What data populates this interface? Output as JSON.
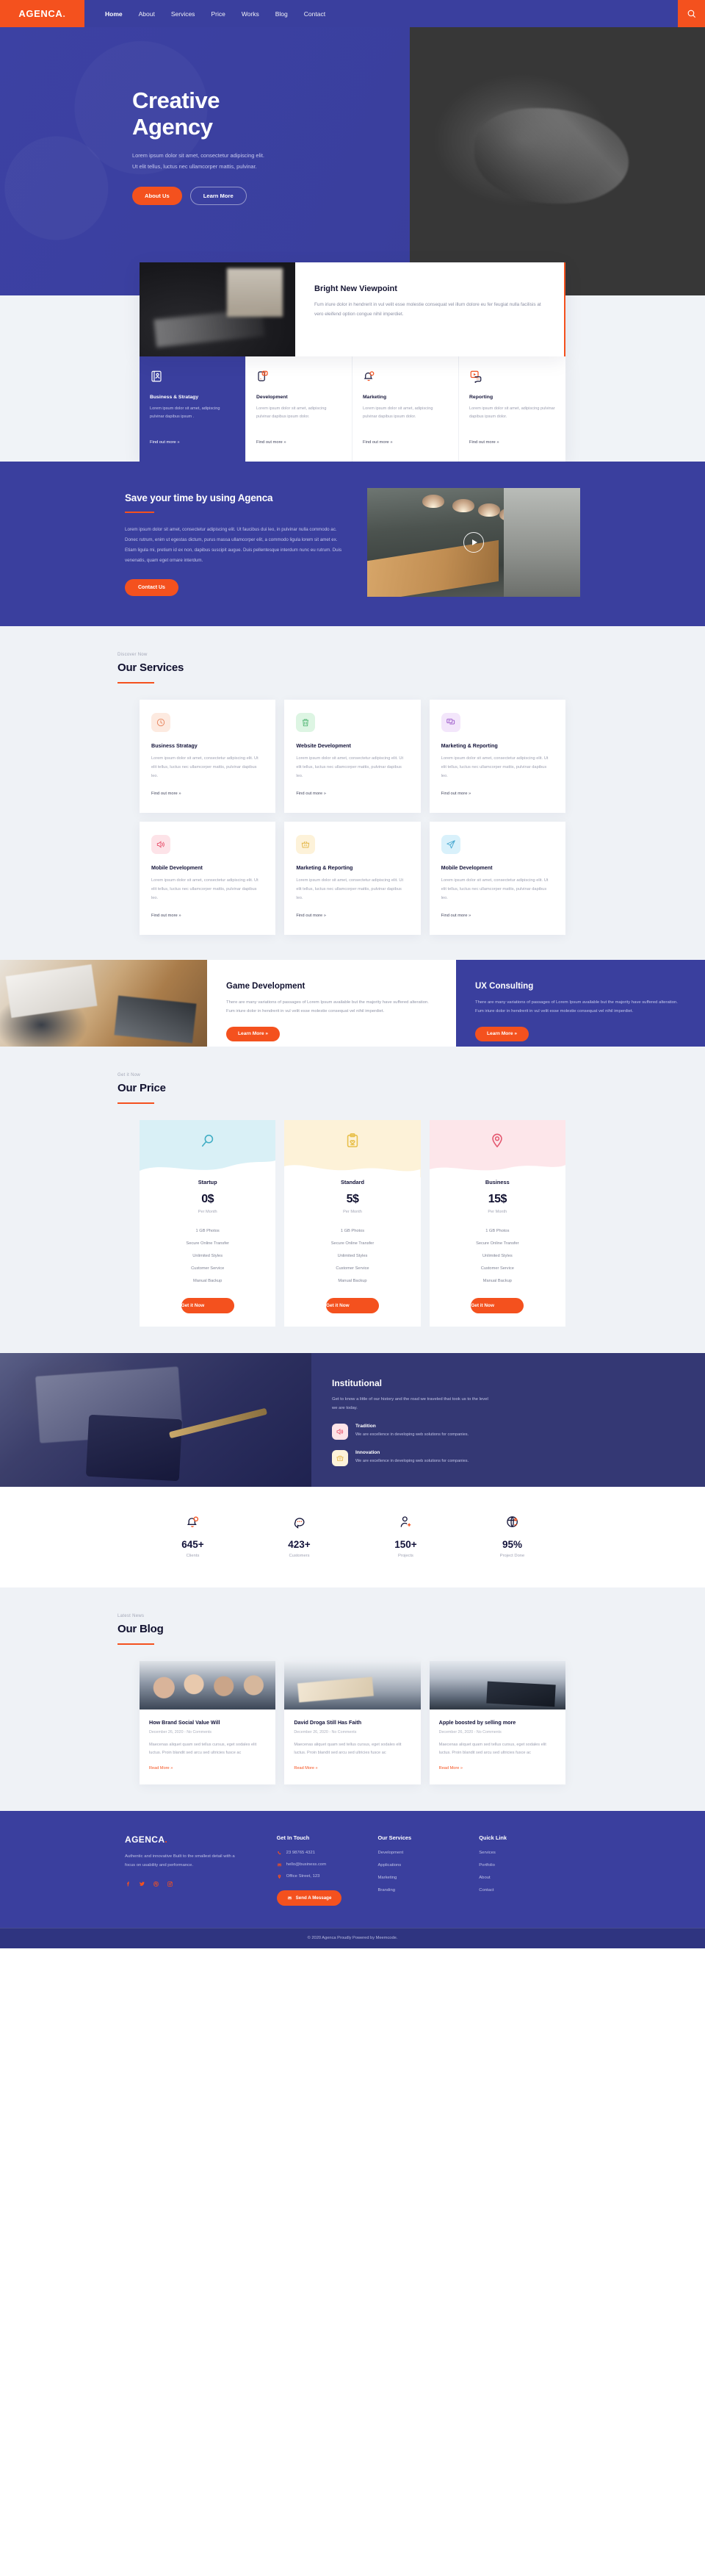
{
  "brand": {
    "name": "AGENCA",
    "dot": "."
  },
  "colors": {
    "primary": "#3a3f9e",
    "accent": "#f4511e",
    "dark": "#343874",
    "bg_grey": "#eff2f6"
  },
  "header": {
    "nav": [
      {
        "label": "Home",
        "active": true
      },
      {
        "label": "About",
        "active": false
      },
      {
        "label": "Services",
        "active": false
      },
      {
        "label": "Price",
        "active": false
      },
      {
        "label": "Works",
        "active": false
      },
      {
        "label": "Blog",
        "active": false
      },
      {
        "label": "Contact",
        "active": false
      }
    ],
    "search_icon": "search-icon"
  },
  "hero": {
    "title_line1": "Creative",
    "title_line2": "Agency",
    "subtitle": "Lorem ipsum dolor sit amet, consectetur adipiscing elit. Ut elit tellus, luctus nec ullamcorper mattis, pulvinar.",
    "btn_primary": "About Us",
    "btn_ghost": "Learn More"
  },
  "viewpoint": {
    "title": "Bright New Viewpoint",
    "body": "Fum iriure dolor in hendrerit in vul velit esse molestie consequat vel illum dolore eu fer feugiat nulla facilisis at vero eleifend option congue nihil imperdiet."
  },
  "features": [
    {
      "icon": "id-card-icon",
      "title": "Business & Stratagy",
      "desc": "Lorem ipsum dolor sit amet, adipiscing pulvinar dapibus ipsum .",
      "link": "Find out more",
      "active": true
    },
    {
      "icon": "chat-mobile-icon",
      "title": "Development",
      "desc": "Lorem ipsum dolor sit amet, adipiscing pulvinar dapibus ipsum dolor.",
      "link": "Find out more",
      "active": false
    },
    {
      "icon": "bell-alert-icon",
      "title": "Marketing",
      "desc": "Lorem ipsum dolor sit amet, adipiscing pulvinar dapibus ipsum dolor.",
      "link": "Find out more",
      "active": false
    },
    {
      "icon": "video-chat-icon",
      "title": "Reporting",
      "desc": "Lorem ipsum dolor sit amet, adipiscing pulvinar dapibus ipsum dolor.",
      "link": "Find out more",
      "active": false
    }
  ],
  "savetime": {
    "title": "Save your time by using Agenca",
    "body": "Lorem ipsum dolor sit amet, consectetur adipiscing elit. Ut faucibus dui leo, in pulvinar nulla commodo ac. Donec rutrum, enim ut egestas dictum, purus massa ullamcorper elit, a commodo ligula lorem sit amet ex. Etiam ligula mi, pretium id ex non, dapibus suscipit augue. Duis pellentesque interdum nunc eu rutrum. Duis venenatis, quam eget ornare interdum.",
    "button": "Contact Us",
    "play_icon": "play-icon"
  },
  "services": {
    "eyebrow": "Discover Now",
    "title": "Our Services",
    "cards": [
      {
        "icon": "clock-icon",
        "icon_bg": "#fdeae0",
        "icon_color": "#e8845c",
        "title": "Business Stratagy",
        "desc": "Lorem ipsum dolor sit amet, consectetur adipiscing elit. Ut elit tellus, luctus nec ullamcorper mattis, pulvinar dapibus leo.",
        "link": "Find out more"
      },
      {
        "icon": "trash-icon",
        "icon_bg": "#ddf5e3",
        "icon_color": "#55b877",
        "title": "Website Development",
        "desc": "Lorem ipsum dolor sit amet, consectetur adipiscing elit. Ut elit tellus, luctus nec ullamcorper mattis, pulvinar dapibus leo.",
        "link": "Find out more"
      },
      {
        "icon": "chat-bubbles-icon",
        "icon_bg": "#f3e6fb",
        "icon_color": "#9b59c9",
        "title": "Marketing & Reporting",
        "desc": "Lorem ipsum dolor sit amet, consectetur adipiscing elit. Ut elit tellus, luctus nec ullamcorper mattis, pulvinar dapibus leo.",
        "link": "Find out more"
      },
      {
        "icon": "speaker-icon",
        "icon_bg": "#fde3e8",
        "icon_color": "#e8556f",
        "title": "Mobile Development",
        "desc": "Lorem ipsum dolor sit amet, consectetur adipiscing elit. Ut elit tellus, luctus nec ullamcorper mattis, pulvinar dapibus leo.",
        "link": "Find out more"
      },
      {
        "icon": "basket-icon",
        "icon_bg": "#fdf2d9",
        "icon_color": "#e3b544",
        "title": "Marketing & Reporting",
        "desc": "Lorem ipsum dolor sit amet, consectetur adipiscing elit. Ut elit tellus, luctus nec ullamcorper mattis, pulvinar dapibus leo.",
        "link": "Find out more"
      },
      {
        "icon": "paper-plane-icon",
        "icon_bg": "#d9f1fb",
        "icon_color": "#49a8d0",
        "title": "Mobile Development",
        "desc": "Lorem ipsum dolor sit amet, consectetur adipiscing elit. Ut elit tellus, luctus nec ullamcorper mattis, pulvinar dapibus leo.",
        "link": "Find out more"
      }
    ]
  },
  "promo": [
    {
      "title": "Game Development",
      "body": "There are many variations of passages of Lorem Ipsum available but the majority have suffered alteration. Fum iriure dolor in hendrerit in vul velit esse molestie consequat vel  nihil imperdiet.",
      "button": "Learn More",
      "theme": "white"
    },
    {
      "title": "UX Consulting",
      "body": "There are many variations of passages of Lorem Ipsum available but the majority have suffered alteration. Fum iriure dolor in hendrerit in vul velit esse molestie consequat vel  nihil imperdiet.",
      "button": "Learn More",
      "theme": "blue"
    }
  ],
  "pricing": {
    "eyebrow": "Get it Now",
    "title": "Our Price",
    "plans": [
      {
        "icon": "magnifier-icon",
        "icon_color": "#3fadc4",
        "blob": "#d9f0f6",
        "name": "Startup",
        "amount": "0$",
        "period": "Per Month",
        "features": [
          "1 GB Photos",
          "Secure Online Transfer",
          "Unlimited Styles",
          "Customer Service",
          "Manual Backup"
        ],
        "button": "Get it Now"
      },
      {
        "icon": "clipboard-heart-icon",
        "icon_color": "#e8c04b",
        "blob": "#fdf2d8",
        "name": "Standard",
        "amount": "5$",
        "period": "Per Month",
        "features": [
          "1 GB Photos",
          "Secure Online Transfer",
          "Unlimited Styles",
          "Customer Service",
          "Manual Backup"
        ],
        "button": "Get it Now"
      },
      {
        "icon": "map-pin-icon",
        "icon_color": "#e4566e",
        "blob": "#fde6ea",
        "name": "Business",
        "amount": "15$",
        "period": "Per Month",
        "features": [
          "1 GB Photos",
          "Secure Online Transfer",
          "Unlimited Styles",
          "Customer Service",
          "Manual Backup"
        ],
        "button": "Get it Now"
      }
    ]
  },
  "institutional": {
    "title": "Institutional",
    "body": "Get to know a little of our history and the road we traveled that took us to the level we are today.",
    "items": [
      {
        "icon": "speaker-icon",
        "icon_bg": "#fde3e8",
        "icon_color": "#e8556f",
        "title": "Tradition",
        "desc": "We are excellence in developing web solutions for companies."
      },
      {
        "icon": "basket-icon",
        "icon_bg": "#fdf3da",
        "icon_color": "#e3b544",
        "title": "Innovation",
        "desc": "We are excellence in developing web solutions for companies."
      }
    ]
  },
  "stats": [
    {
      "icon": "bell-alert-icon",
      "number": "645+",
      "label": "Clients"
    },
    {
      "icon": "chat-dots-icon",
      "number": "423+",
      "label": "Customers"
    },
    {
      "icon": "user-plus-icon",
      "number": "150+",
      "label": "Projects"
    },
    {
      "icon": "globe-chart-icon",
      "number": "95%",
      "label": "Project Done"
    }
  ],
  "blog": {
    "eyebrow": "Latest News",
    "title": "Our Blog",
    "posts": [
      {
        "thumb": "people-group-photo",
        "title": "How Brand Social Value Will",
        "meta": "December 26, 2020 - No Comments",
        "excerpt": "Maecenas aliquet quam sed tellus cursus, eget sodales elit luctus. Proin blandit sed arcu sed ultricies fusce ac",
        "link": "Read More »"
      },
      {
        "thumb": "desk-work-photo",
        "title": "David Droga Still Has Faith",
        "meta": "December 26, 2020 - No Comments",
        "excerpt": "Maecenas aliquet quam sed tellus cursus, eget sodales elit luctus. Proin blandit sed arcu sed ultricies fusce ac",
        "link": "Read More »"
      },
      {
        "thumb": "keyboard-hands-photo",
        "title": "Apple boosted by selling more",
        "meta": "December 26, 2020 - No Comments",
        "excerpt": "Maecenas aliquet quam sed tellus cursus, eget sodales elit luctus. Proin blandit sed arcu sed ultricies fusce ac",
        "link": "Read More »"
      }
    ]
  },
  "footer": {
    "brand": "AGENCA",
    "brand_dot": ".",
    "about": "Authentic and innovative Built to the smallest detail with a focus on usability and performance.",
    "socials": [
      "facebook-icon",
      "twitter-icon",
      "dribbble-icon",
      "instagram-icon"
    ],
    "contact": {
      "title": "Get In Touch",
      "phone": "23 98765 4321",
      "email": "hello@business.com",
      "address": "Office Street, 123",
      "button": "Send A Message"
    },
    "services": {
      "title": "Our Services",
      "links": [
        "Development",
        "Applications",
        "Marketing",
        "Branding"
      ]
    },
    "quicklink": {
      "title": "Quick Link",
      "links": [
        "Services",
        "Portfolio",
        "About",
        "Contact"
      ]
    },
    "copyright": "© 2020 Agenca Proudly Powered by Meemcode."
  }
}
